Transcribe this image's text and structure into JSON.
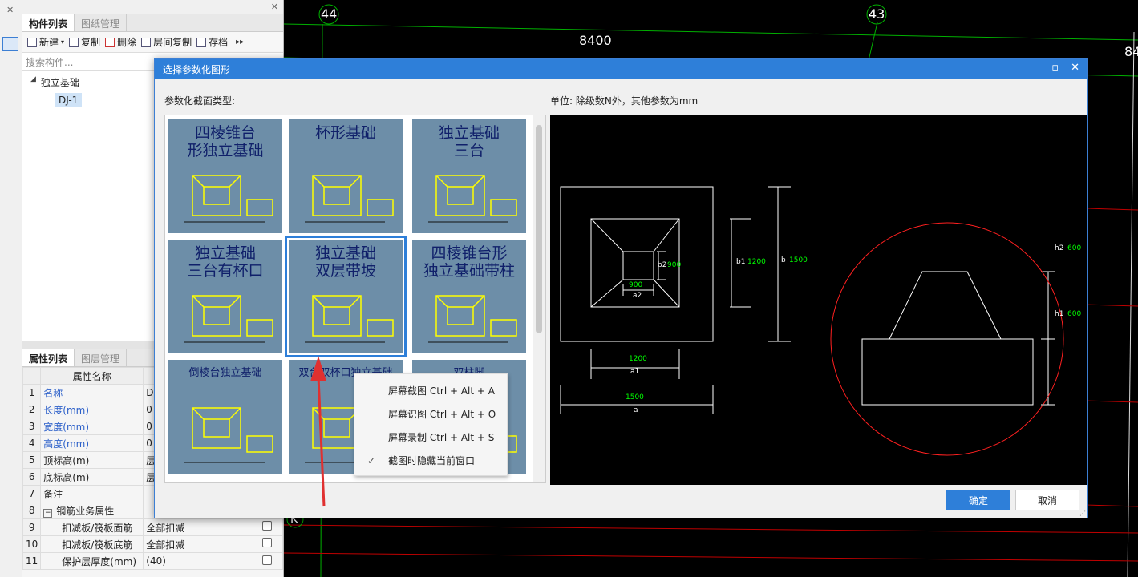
{
  "left_panel": {
    "tabs_top": [
      "构件列表",
      "图纸管理"
    ],
    "toolbar": {
      "new": "新建",
      "copy": "复制",
      "delete": "删除",
      "floor_copy": "层间复制",
      "save": "存档"
    },
    "search_placeholder": "搜索构件...",
    "tree_root": "独立基础",
    "tree_item": "DJ-1",
    "tabs_bottom": [
      "属性列表",
      "图层管理"
    ],
    "prop_header": "属性名称",
    "props": [
      {
        "n": "1",
        "name": "名称",
        "val": "D",
        "blue": true
      },
      {
        "n": "2",
        "name": "长度(mm)",
        "val": "0",
        "blue": true
      },
      {
        "n": "3",
        "name": "宽度(mm)",
        "val": "0",
        "blue": true
      },
      {
        "n": "4",
        "name": "高度(mm)",
        "val": "0",
        "blue": true
      },
      {
        "n": "5",
        "name": "顶标高(m)",
        "val": "层",
        "blue": false
      },
      {
        "n": "6",
        "name": "底标高(m)",
        "val": "层",
        "blue": false
      },
      {
        "n": "7",
        "name": "备注",
        "val": "",
        "blue": false
      },
      {
        "n": "8",
        "name": "钢筋业务属性",
        "val": "",
        "blue": false
      },
      {
        "n": "9",
        "name": "扣减板/筏板面筋",
        "val": "全部扣减",
        "blue": false
      },
      {
        "n": "10",
        "name": "扣减板/筏板底筋",
        "val": "全部扣减",
        "blue": false
      },
      {
        "n": "11",
        "name": "保护层厚度(mm)",
        "val": "(40)",
        "blue": false
      }
    ]
  },
  "cad": {
    "axis_labels": [
      "44",
      "43"
    ],
    "dim_top": "8400",
    "dim_right": "84",
    "axis_k": "K"
  },
  "dialog": {
    "title": "选择参数化图形",
    "section_label": "参数化截面类型:",
    "unit_label": "单位:   除级数N外，其他参数为mm",
    "thumbs": [
      {
        "title": [
          "四棱锥台",
          "形独立基础"
        ]
      },
      {
        "title": [
          "杯形基础"
        ]
      },
      {
        "title": [
          "独立基础",
          "三台"
        ]
      },
      {
        "title": [
          "独立基础",
          "三台有杯口"
        ]
      },
      {
        "title": [
          "独立基础",
          "双层带坡"
        ]
      },
      {
        "title": [
          "四棱锥台形",
          "独立基础带柱"
        ]
      },
      {
        "title": [
          "倒棱台独立基础"
        ]
      },
      {
        "title": [
          "双台双杯口独立基础"
        ]
      },
      {
        "title": [
          "双柱脚"
        ]
      }
    ],
    "preview": {
      "b2": "900",
      "a2": "900",
      "a2_label": "a2",
      "b1": "1200",
      "b": "1500",
      "a1": "1200",
      "a": "1500",
      "h2": "600",
      "h1": "600"
    },
    "ok": "确定",
    "cancel": "取消"
  },
  "context_menu": [
    {
      "label": "屏幕截图 Ctrl + Alt + A",
      "checked": false
    },
    {
      "label": "屏幕识图 Ctrl + Alt + O",
      "checked": false
    },
    {
      "label": "屏幕录制 Ctrl + Alt + S",
      "checked": false
    },
    {
      "label": "截图时隐藏当前窗口",
      "checked": true
    }
  ],
  "colors": {
    "dialog_title": "#2e7fd9",
    "selection": "#2e7fd9",
    "thumb_bg": "#6d8ea8",
    "yellow": "#ffff00",
    "dim_green": "#00ff00",
    "circle_red": "#ff2020"
  }
}
